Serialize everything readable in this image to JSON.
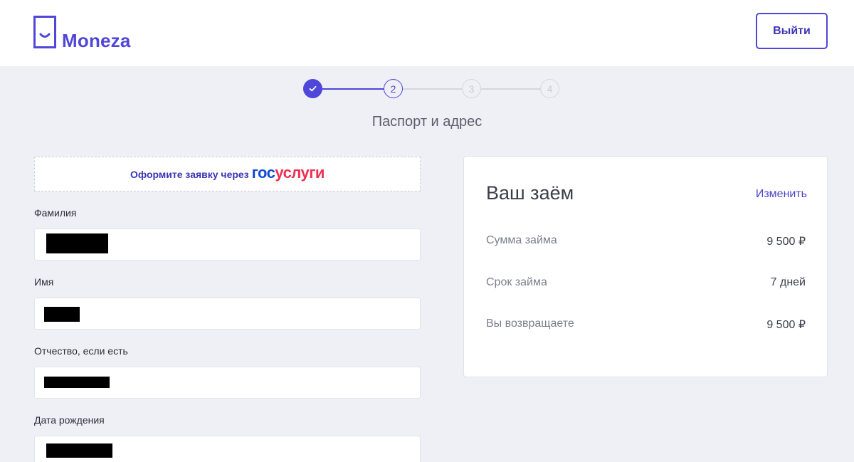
{
  "header": {
    "brand": "Moneza",
    "logout_label": "Выйти"
  },
  "stepper": {
    "steps": [
      {
        "label": "",
        "state": "done"
      },
      {
        "label": "2",
        "state": "active"
      },
      {
        "label": "3",
        "state": "todo"
      },
      {
        "label": "4",
        "state": "todo"
      }
    ],
    "current_title": "Паспорт и адрес"
  },
  "form": {
    "gosuslugi_prompt": "Оформите заявку через",
    "gosuslugi_logo_part1": "гос",
    "gosuslugi_logo_part2": "услуги",
    "fields": [
      {
        "label": "Фамилия",
        "value": "[redacted]"
      },
      {
        "label": "Имя",
        "value": "[redacted]"
      },
      {
        "label": "Отчество, если есть",
        "value": "[redacted]"
      },
      {
        "label": "Дата рождения",
        "value": "[redacted]"
      }
    ]
  },
  "loan": {
    "title": "Ваш заём",
    "edit_label": "Изменить",
    "rows": [
      {
        "label": "Сумма займа",
        "value": "9 500 ₽"
      },
      {
        "label": "Срок займа",
        "value": "7 дней"
      },
      {
        "label": "Вы возвращаете",
        "value": "9 500 ₽"
      }
    ]
  },
  "colors": {
    "accent": "#5046d9",
    "background": "#eef0f5",
    "gosuslugi_blue": "#0d4cd3",
    "gosuslugi_red": "#ee2f53"
  }
}
